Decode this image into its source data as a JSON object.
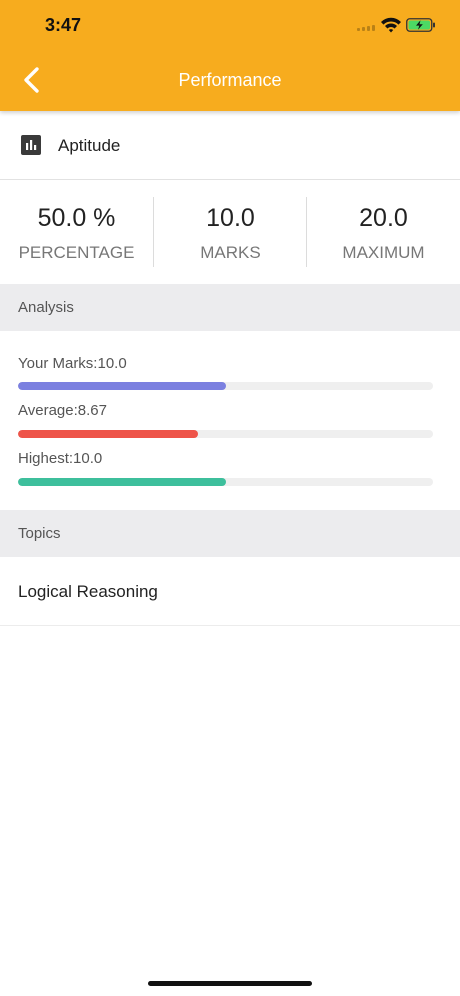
{
  "status_bar": {
    "time": "3:47"
  },
  "header": {
    "title": "Performance",
    "back_icon": "chevron-left-icon",
    "color": "#F7AC1E"
  },
  "subject": {
    "icon": "bar-chart-icon",
    "label": "Aptitude"
  },
  "stats": [
    {
      "value": "50.0 %",
      "label": "PERCENTAGE"
    },
    {
      "value": "10.0",
      "label": "MARKS"
    },
    {
      "value": "20.0",
      "label": "MAXIMUM"
    }
  ],
  "analysis": {
    "title": "Analysis",
    "bars": [
      {
        "label": "Your Marks:10.0",
        "fraction": 0.5,
        "color": "#7B80E0"
      },
      {
        "label": "Average:8.67",
        "fraction": 0.4335,
        "color": "#EE5449"
      },
      {
        "label": "Highest:10.0",
        "fraction": 0.5,
        "color": "#3DBF9C"
      }
    ]
  },
  "topics": {
    "title": "Topics",
    "items": [
      "Logical Reasoning"
    ]
  }
}
